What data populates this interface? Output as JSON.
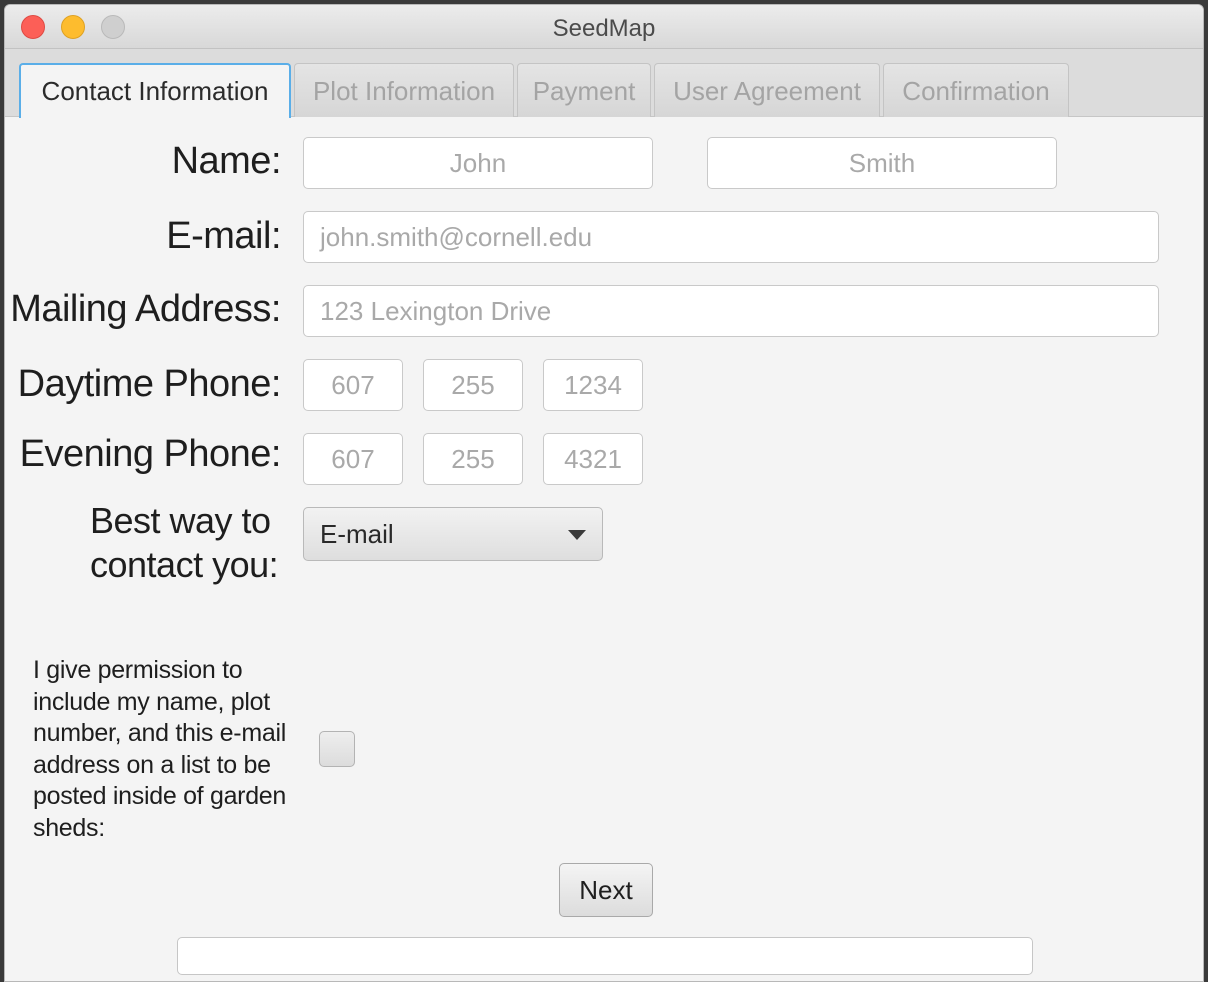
{
  "window": {
    "title": "SeedMap"
  },
  "tabs": [
    {
      "label": "Contact Information",
      "active": true
    },
    {
      "label": "Plot Information",
      "active": false
    },
    {
      "label": "Payment",
      "active": false
    },
    {
      "label": "User Agreement",
      "active": false
    },
    {
      "label": "Confirmation",
      "active": false
    }
  ],
  "form": {
    "name_label": "Name:",
    "first_name_placeholder": "John",
    "last_name_placeholder": "Smith",
    "email_label": "E-mail:",
    "email_placeholder": "john.smith@cornell.edu",
    "address_label": "Mailing Address:",
    "address_placeholder": "123 Lexington Drive",
    "daytime_label": "Daytime Phone:",
    "daytime_area": "607",
    "daytime_prefix": "255",
    "daytime_line": "1234",
    "evening_label": "Evening Phone:",
    "evening_area": "607",
    "evening_prefix": "255",
    "evening_line": "4321",
    "contact_label_line1": "Best way to",
    "contact_label_line2": "contact you:",
    "contact_selected": "E-mail",
    "permission_text": "I give permission to include my name, plot number, and this e-mail address on a list to be posted inside of garden sheds:",
    "permission_checked": false,
    "next_label": "Next",
    "status_text": ""
  },
  "colors": {
    "close": "#fc5f57",
    "minimize": "#fdbc2e",
    "active_tab_border": "#5aaee8"
  }
}
